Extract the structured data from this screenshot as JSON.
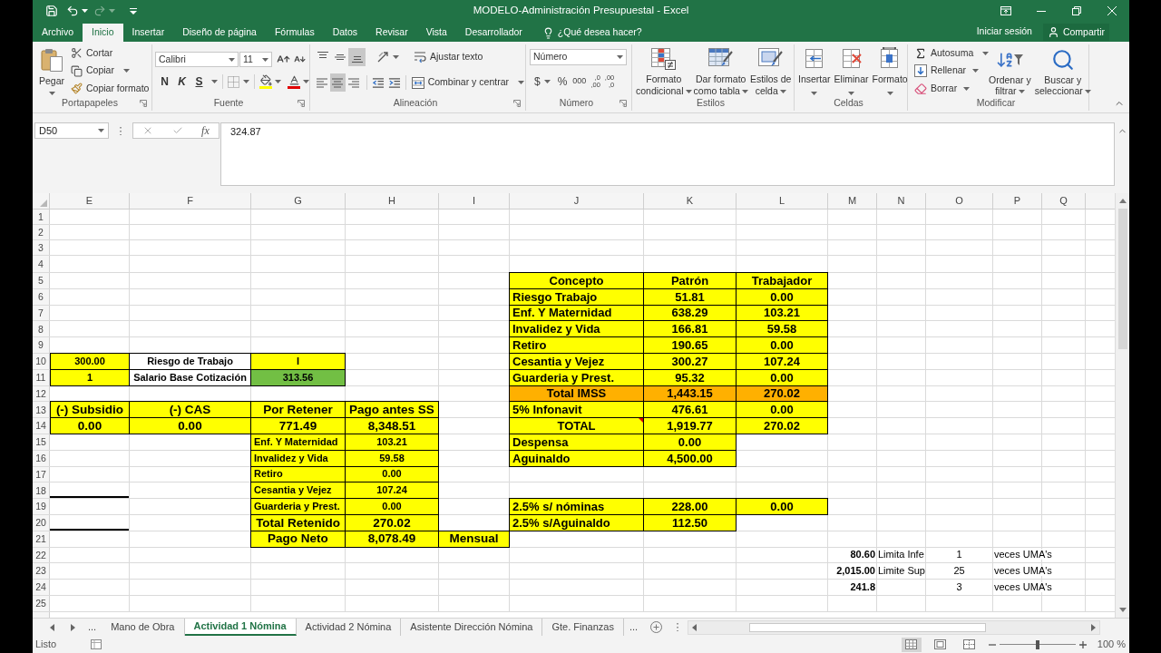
{
  "title_bar": {
    "title": "MODELO-Administración Presupuestal - Excel"
  },
  "menu_tabs": [
    {
      "label": "Archivo",
      "selected": false
    },
    {
      "label": "Inicio",
      "selected": true
    },
    {
      "label": "Insertar",
      "selected": false
    },
    {
      "label": "Diseño de página",
      "selected": false
    },
    {
      "label": "Fórmulas",
      "selected": false
    },
    {
      "label": "Datos",
      "selected": false
    },
    {
      "label": "Revisar",
      "selected": false
    },
    {
      "label": "Vista",
      "selected": false
    },
    {
      "label": "Desarrollador",
      "selected": false
    }
  ],
  "tell_me": {
    "placeholder": "¿Qué desea hacer?"
  },
  "account": {
    "sign_in": "Iniciar sesión",
    "share": "Compartir"
  },
  "ribbon": [
    {
      "kind": "clipboard",
      "label": "Portapapeles",
      "launcher": true,
      "paste": "Pegar",
      "commands": [
        "Cortar",
        "Copiar",
        "Copiar formato"
      ]
    },
    {
      "kind": "font",
      "label": "Fuente",
      "launcher": true,
      "font_name": "Calibri",
      "font_size": "11",
      "styles": [
        "N",
        "K",
        "S"
      ]
    },
    {
      "kind": "alignment",
      "label": "Alineación",
      "launcher": true,
      "vertical": [
        {
          "selected": false
        },
        {
          "selected": false
        },
        {
          "selected": true
        }
      ],
      "horizontal": [
        {
          "selected": false
        },
        {
          "selected": true
        },
        {
          "selected": false
        }
      ],
      "wrap": "Ajustar texto",
      "merge": "Combinar y centrar"
    },
    {
      "kind": "number",
      "label": "Número",
      "launcher": true,
      "format": "Número",
      "symbols": [
        "$",
        "%",
        "000"
      ],
      "decimals": [
        [
          ",0",
          ",00"
        ],
        [
          ",00",
          ",0"
        ]
      ]
    },
    {
      "kind": "styles",
      "label": "Estilos",
      "launcher": false,
      "commands": [
        [
          "Formato",
          "condicional"
        ],
        [
          "Dar formato",
          "como tabla"
        ],
        [
          "Estilos de",
          "celda"
        ]
      ]
    },
    {
      "kind": "cells",
      "label": "Celdas",
      "launcher": false,
      "commands": [
        "Insertar",
        "Eliminar",
        "Formato"
      ]
    },
    {
      "kind": "editing",
      "label": "Modificar",
      "launcher": false,
      "commands": [
        "Autosuma",
        "Rellenar",
        "Borrar"
      ],
      "tools": [
        [
          "Ordenar y",
          "filtrar"
        ],
        [
          "Buscar y",
          "seleccionar"
        ]
      ]
    }
  ],
  "formula_bar": {
    "name_box": "D50",
    "function_button": "fx",
    "value": "324.87"
  },
  "sheet": {
    "columns": [
      "E",
      "F",
      "G",
      "H",
      "I",
      "J",
      "K",
      "L",
      "M",
      "N",
      "O",
      "P",
      "Q"
    ],
    "rows": [
      {
        "number": "1"
      },
      {
        "number": "2"
      },
      {
        "number": "3"
      },
      {
        "number": "4"
      },
      {
        "number": "5",
        "cells": [
          null,
          null,
          null,
          null,
          null,
          {
            "text": "Concepto",
            "kind": "amount",
            "color": "#ffff00"
          },
          {
            "text": "Patrón",
            "kind": "amount",
            "color": "#ffff00"
          },
          {
            "text": "Trabajador",
            "kind": "amount",
            "color": "#ffff00"
          }
        ]
      },
      {
        "number": "6",
        "cells": [
          null,
          null,
          null,
          null,
          null,
          {
            "text": "Riesgo Trabajo",
            "kind": "label",
            "color": "#ffff00"
          },
          {
            "text": "51.81",
            "kind": "amount",
            "color": "#ffff00"
          },
          {
            "text": "0.00",
            "kind": "amount",
            "color": "#ffff00"
          }
        ]
      },
      {
        "number": "7",
        "cells": [
          null,
          null,
          null,
          null,
          null,
          {
            "text": "Enf. Y Maternidad",
            "kind": "label",
            "color": "#ffff00"
          },
          {
            "text": "638.29",
            "kind": "amount",
            "color": "#ffff00"
          },
          {
            "text": "103.21",
            "kind": "amount",
            "color": "#ffff00"
          }
        ]
      },
      {
        "number": "8",
        "cells": [
          null,
          null,
          null,
          null,
          null,
          {
            "text": "Invalidez y Vida",
            "kind": "label",
            "color": "#ffff00"
          },
          {
            "text": "166.81",
            "kind": "amount",
            "color": "#ffff00"
          },
          {
            "text": "59.58",
            "kind": "amount",
            "color": "#ffff00"
          }
        ]
      },
      {
        "number": "9",
        "cells": [
          null,
          null,
          null,
          null,
          null,
          {
            "text": "Retiro",
            "kind": "label",
            "color": "#ffff00"
          },
          {
            "text": "190.65",
            "kind": "amount",
            "color": "#ffff00"
          },
          {
            "text": "0.00",
            "kind": "amount",
            "color": "#ffff00"
          }
        ]
      },
      {
        "number": "10",
        "cells": [
          {
            "text": "300.00",
            "kind": "small",
            "color": "#ffff00"
          },
          {
            "text": "Riesgo de Trabajo",
            "kind": "small",
            "color": "#ffffff"
          },
          {
            "text": "I",
            "kind": "small",
            "color": "#ffff00"
          },
          null,
          null,
          {
            "text": "Cesantia y Vejez",
            "kind": "label",
            "color": "#ffff00"
          },
          {
            "text": "300.27",
            "kind": "amount",
            "color": "#ffff00"
          },
          {
            "text": "107.24",
            "kind": "amount",
            "color": "#ffff00"
          }
        ]
      },
      {
        "number": "11",
        "cells": [
          {
            "text": "1",
            "kind": "small",
            "color": "#ffff00"
          },
          {
            "text": "Salario Base Cotización",
            "kind": "small",
            "color": "#ffffff"
          },
          {
            "text": "313.56",
            "kind": "small",
            "color": "#72bf44"
          },
          null,
          null,
          {
            "text": "Guarderia y Prest.",
            "kind": "label",
            "color": "#ffff00"
          },
          {
            "text": "95.32",
            "kind": "amount",
            "color": "#ffff00"
          },
          {
            "text": "0.00",
            "kind": "amount",
            "color": "#ffff00"
          }
        ]
      },
      {
        "number": "12",
        "cells": [
          null,
          null,
          null,
          null,
          null,
          {
            "text": "Total IMSS",
            "kind": "amount",
            "color": "#ffb000"
          },
          {
            "text": "1,443.15",
            "kind": "amount",
            "color": "#ffb000"
          },
          {
            "text": "270.02",
            "kind": "amount",
            "color": "#ffb000"
          }
        ]
      },
      {
        "number": "13",
        "cells": [
          {
            "text": "(-) Subsidio",
            "kind": "title",
            "color": "#ffff00"
          },
          {
            "text": "(-) CAS",
            "kind": "title",
            "color": "#ffff00"
          },
          {
            "text": "Por Retener",
            "kind": "title",
            "color": "#ffff00"
          },
          {
            "text": "Pago antes SS",
            "kind": "title",
            "color": "#ffff00"
          },
          null,
          {
            "text": "5% Infonavit",
            "kind": "label",
            "color": "#ffff00"
          },
          {
            "text": "476.61",
            "kind": "amount",
            "color": "#ffff00"
          },
          {
            "text": "0.00",
            "kind": "amount",
            "color": "#ffff00"
          }
        ]
      },
      {
        "number": "14",
        "cells": [
          {
            "text": "0.00",
            "kind": "title",
            "color": "#ffff00"
          },
          {
            "text": "0.00",
            "kind": "title",
            "color": "#ffff00"
          },
          {
            "text": "771.49",
            "kind": "title",
            "color": "#ffff00"
          },
          {
            "text": "8,348.51",
            "kind": "title",
            "color": "#ffff00"
          },
          null,
          {
            "text": "TOTAL",
            "kind": "amount",
            "color": "#ffff00",
            "comment": true
          },
          {
            "text": "1,919.77",
            "kind": "amount",
            "color": "#ffff00"
          },
          {
            "text": "270.02",
            "kind": "amount",
            "color": "#ffff00"
          }
        ]
      },
      {
        "number": "15",
        "cells": [
          null,
          null,
          {
            "text": "Enf. Y Maternidad",
            "kind": "item",
            "color": "#ffff00"
          },
          {
            "text": "103.21",
            "kind": "figure",
            "color": "#ffff00"
          },
          null,
          {
            "text": "Despensa",
            "kind": "label",
            "color": "#ffff00"
          },
          {
            "text": "0.00",
            "kind": "amount",
            "color": "#ffff00"
          }
        ]
      },
      {
        "number": "16",
        "cells": [
          null,
          null,
          {
            "text": "Invalidez y Vida",
            "kind": "item",
            "color": "#ffff00"
          },
          {
            "text": "59.58",
            "kind": "figure",
            "color": "#ffff00"
          },
          null,
          {
            "text": "Aguinaldo",
            "kind": "label",
            "color": "#ffff00"
          },
          {
            "text": "4,500.00",
            "kind": "amount",
            "color": "#ffff00"
          }
        ]
      },
      {
        "number": "17",
        "cells": [
          null,
          null,
          {
            "text": "Retiro",
            "kind": "item",
            "color": "#ffff00"
          },
          {
            "text": "0.00",
            "kind": "figure",
            "color": "#ffff00"
          }
        ]
      },
      {
        "number": "18",
        "cells": [
          {
            "kind": "rule"
          },
          null,
          {
            "text": "Cesantia y Vejez",
            "kind": "item",
            "color": "#ffff00"
          },
          {
            "text": "107.24",
            "kind": "figure",
            "color": "#ffff00"
          }
        ]
      },
      {
        "number": "19",
        "cells": [
          null,
          null,
          {
            "text": "Guarderia y Prest.",
            "kind": "item",
            "color": "#ffff00"
          },
          {
            "text": "0.00",
            "kind": "figure",
            "color": "#ffff00"
          },
          null,
          {
            "text": "2.5% s/ nóminas",
            "kind": "label",
            "color": "#ffff00"
          },
          {
            "text": "228.00",
            "kind": "amount",
            "color": "#ffff00"
          },
          {
            "text": "0.00",
            "kind": "amount",
            "color": "#ffff00"
          }
        ]
      },
      {
        "number": "20",
        "cells": [
          {
            "kind": "rule"
          },
          null,
          {
            "text": "Total Retenido",
            "kind": "title",
            "color": "#ffff00"
          },
          {
            "text": "270.02",
            "kind": "title",
            "color": "#ffff00"
          },
          null,
          {
            "text": "2.5% s/Aguinaldo",
            "kind": "label",
            "color": "#ffff00"
          },
          {
            "text": "112.50",
            "kind": "amount",
            "color": "#ffff00"
          }
        ]
      },
      {
        "number": "21",
        "cells": [
          null,
          null,
          {
            "text": "Pago Neto",
            "kind": "title",
            "color": "#ffff00"
          },
          {
            "text": "8,078.49",
            "kind": "title",
            "color": "#ffff00"
          },
          {
            "text": "Mensual",
            "kind": "title",
            "color": "#ffff00"
          }
        ]
      },
      {
        "number": "22",
        "cells": [
          null,
          null,
          null,
          null,
          null,
          null,
          null,
          null,
          {
            "text": "80.60",
            "kind": "total"
          },
          {
            "text": "Limita Infe",
            "kind": "note"
          },
          {
            "text": "1",
            "kind": "count"
          },
          {
            "text": "veces UMA's",
            "kind": "note"
          }
        ]
      },
      {
        "number": "23",
        "cells": [
          null,
          null,
          null,
          null,
          null,
          null,
          null,
          null,
          {
            "text": "2,015.00",
            "kind": "total"
          },
          {
            "text": "Limite Sup",
            "kind": "note"
          },
          {
            "text": "25",
            "kind": "count"
          },
          {
            "text": "veces UMA's",
            "kind": "note"
          }
        ]
      },
      {
        "number": "24",
        "cells": [
          null,
          null,
          null,
          null,
          null,
          null,
          null,
          null,
          {
            "text": "241.8",
            "kind": "total"
          },
          null,
          {
            "text": "3",
            "kind": "count"
          },
          {
            "text": "veces UMA's",
            "kind": "note"
          }
        ]
      },
      {
        "number": "25"
      }
    ]
  },
  "sheet_tabs": {
    "more_before": "...",
    "tabs": [
      {
        "label": "Mano de Obra",
        "selected": false
      },
      {
        "label": "Actividad 1 Nómina",
        "selected": true
      },
      {
        "label": "Actividad 2 Nómina",
        "selected": false
      },
      {
        "label": "Asistente Dirección Nómina",
        "selected": false
      },
      {
        "label": "Gte. Finanzas",
        "selected": false
      }
    ],
    "more_after": "..."
  },
  "status_bar": {
    "status": "Listo",
    "views": [
      {
        "selected": true
      },
      {
        "selected": false
      },
      {
        "selected": false
      }
    ],
    "zoom": {
      "level": 0.5,
      "reading": "100 %"
    }
  }
}
